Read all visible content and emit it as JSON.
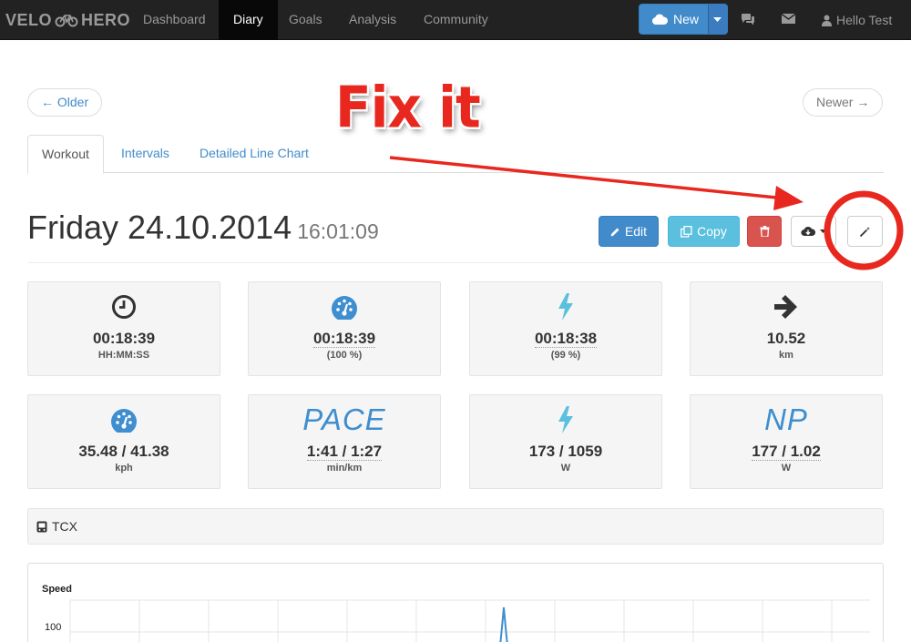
{
  "navbar": {
    "brand_left": "VELO",
    "brand_right": "HERO",
    "items": [
      {
        "label": "Dashboard"
      },
      {
        "label": "Diary"
      },
      {
        "label": "Goals"
      },
      {
        "label": "Analysis"
      },
      {
        "label": "Community"
      }
    ],
    "active_item": "Diary",
    "new_button": "New",
    "user_label": "Hello Test"
  },
  "pager": {
    "older": "← Older",
    "newer": "Newer →"
  },
  "tabs": [
    {
      "label": "Workout"
    },
    {
      "label": "Intervals"
    },
    {
      "label": "Detailed Line Chart"
    }
  ],
  "annotation": {
    "text": "Fix it"
  },
  "workout": {
    "date": "Friday 24.10.2014",
    "time": "16:01:09"
  },
  "actions": {
    "edit": "Edit",
    "copy": "Copy"
  },
  "stats": [
    {
      "icon": "clock-icon",
      "value": "00:18:39",
      "unit": "HH:MM:SS"
    },
    {
      "icon": "speedometer-icon",
      "value": "00:18:39",
      "unit": "(100 %)"
    },
    {
      "icon": "bolt-icon",
      "value": "00:18:38",
      "unit": "(99 %)"
    },
    {
      "icon": "arrow-right-icon",
      "value": "10.52",
      "unit": "km"
    },
    {
      "icon": "speedometer-icon",
      "value": "35.48 / 41.38",
      "unit": "kph"
    },
    {
      "icon_text": "PACE",
      "value": "1:41 / 1:27",
      "unit": "min/km"
    },
    {
      "icon": "bolt-icon",
      "value": "173 / 1059",
      "unit": "W"
    },
    {
      "icon_text": "NP",
      "value": "177 / 1.02",
      "unit": "W"
    }
  ],
  "file": {
    "label": "TCX"
  },
  "chart_data": {
    "type": "line",
    "title": "Speed",
    "y_tick_labels": [
      "100"
    ],
    "grid": true,
    "series": [
      {
        "color": "#3e8ed0"
      }
    ]
  },
  "colors": {
    "primary": "#428bca",
    "info": "#5bc0de",
    "danger": "#d9534f",
    "icon_blue": "#3e8ed0",
    "annotation_red": "#e8281e"
  }
}
